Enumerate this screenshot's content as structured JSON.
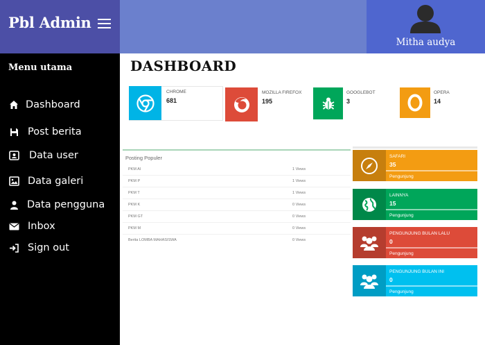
{
  "header": {
    "brand": "Pbl Admin",
    "menu_icon": "hamburger-icon",
    "user_name": "Mitha audya",
    "avatar_icon": "user-avatar-icon"
  },
  "sidebar": {
    "title": "Menu utama",
    "items": [
      {
        "label": "Dashboard",
        "icon": "home-icon"
      },
      {
        "label": "Post berita",
        "icon": "save-icon"
      },
      {
        "label": "Data user",
        "icon": "contact-card-icon"
      },
      {
        "label": "Data galeri",
        "icon": "image-icon"
      },
      {
        "label": "Data pengguna",
        "icon": "user-icon"
      },
      {
        "label": "Inbox",
        "icon": "envelope-icon"
      },
      {
        "label": "Sign out",
        "icon": "sign-out-icon"
      }
    ]
  },
  "main": {
    "title": "DASHBOARD",
    "browsers": [
      {
        "name": "CHROME",
        "value": "681",
        "icon": "chrome-icon",
        "color": "#00b4e6"
      },
      {
        "name": "MOZILLA FIREFOX",
        "value": "195",
        "icon": "firefox-icon",
        "color": "#dd4b39"
      },
      {
        "name": "GOOGLEBOT",
        "value": "3",
        "icon": "bug-icon",
        "color": "#00a65a"
      },
      {
        "name": "OPERA",
        "value": "14",
        "icon": "opera-icon",
        "color": "#f39c12"
      }
    ],
    "popular": {
      "title": "Posting Populer",
      "rows": [
        {
          "name": "PKM AI",
          "views": "1 Views"
        },
        {
          "name": "PKM P",
          "views": "1 Views"
        },
        {
          "name": "PKM T",
          "views": "1 Views"
        },
        {
          "name": "PKM K",
          "views": "0 Views"
        },
        {
          "name": "PKM GT",
          "views": "0 Views"
        },
        {
          "name": "PKM M",
          "views": "0 Views"
        },
        {
          "name": "Berita LOMBA MAHASISWA",
          "views": "0 Views"
        }
      ]
    },
    "info_boxes": [
      {
        "name": "SAFARI",
        "value": "35",
        "desc": "Pengunjung",
        "icon": "compass-icon",
        "color": "#f39c12"
      },
      {
        "name": "LAINNYA",
        "value": "15",
        "desc": "Pengunjung",
        "icon": "globe-icon",
        "color": "#00a65a"
      },
      {
        "name": "PENGUNJUNG BULAN LALU",
        "value": "0",
        "desc": "Pengunjung",
        "icon": "users-icon",
        "color": "#dd4b39"
      },
      {
        "name": "PENGUNJUNG BULAN INI",
        "value": "0",
        "desc": "Pengunjung",
        "icon": "users-icon",
        "color": "#00c0ef"
      }
    ]
  }
}
